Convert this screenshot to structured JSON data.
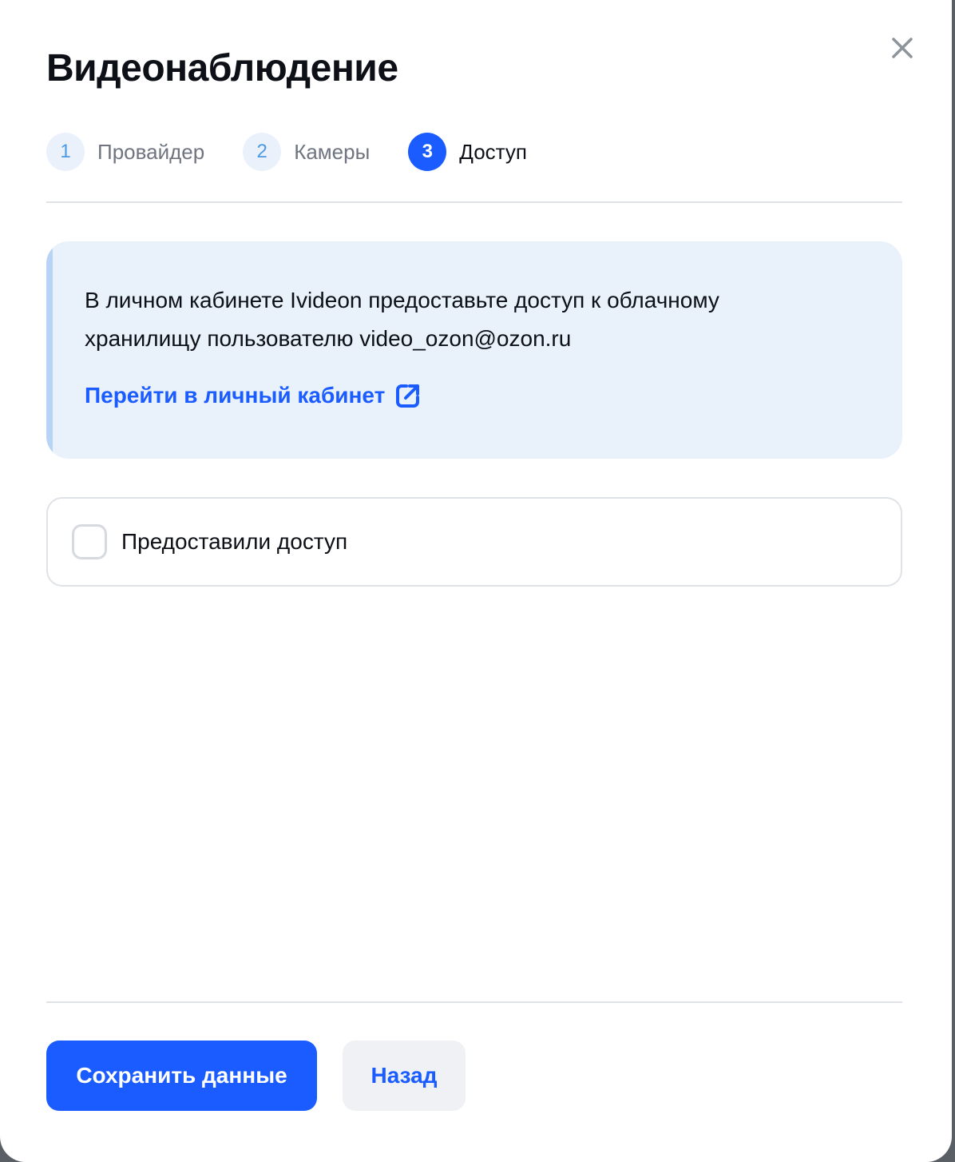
{
  "modal": {
    "title": "Видеонаблюдение",
    "close_icon": "close-icon"
  },
  "steps": [
    {
      "number": "1",
      "label": "Провайдер",
      "state": "completed"
    },
    {
      "number": "2",
      "label": "Камеры",
      "state": "completed"
    },
    {
      "number": "3",
      "label": "Доступ",
      "state": "active"
    }
  ],
  "info": {
    "text_line1": "В личном кабинете Ivideon предоставьте доступ к облачному",
    "text_line2": "хранилищу пользователю video_ozon@ozon.ru",
    "link_label": "Перейти в личный кабинет",
    "link_icon": "external-link-icon"
  },
  "confirm": {
    "label": "Предоставили доступ",
    "checked": false
  },
  "footer": {
    "save_label": "Сохранить данные",
    "back_label": "Назад"
  },
  "colors": {
    "accent": "#1a5cff",
    "info_bg": "#e9f1fb",
    "step_inactive_bg": "#eaf1fa",
    "step_inactive_text": "#4d9ae6"
  }
}
